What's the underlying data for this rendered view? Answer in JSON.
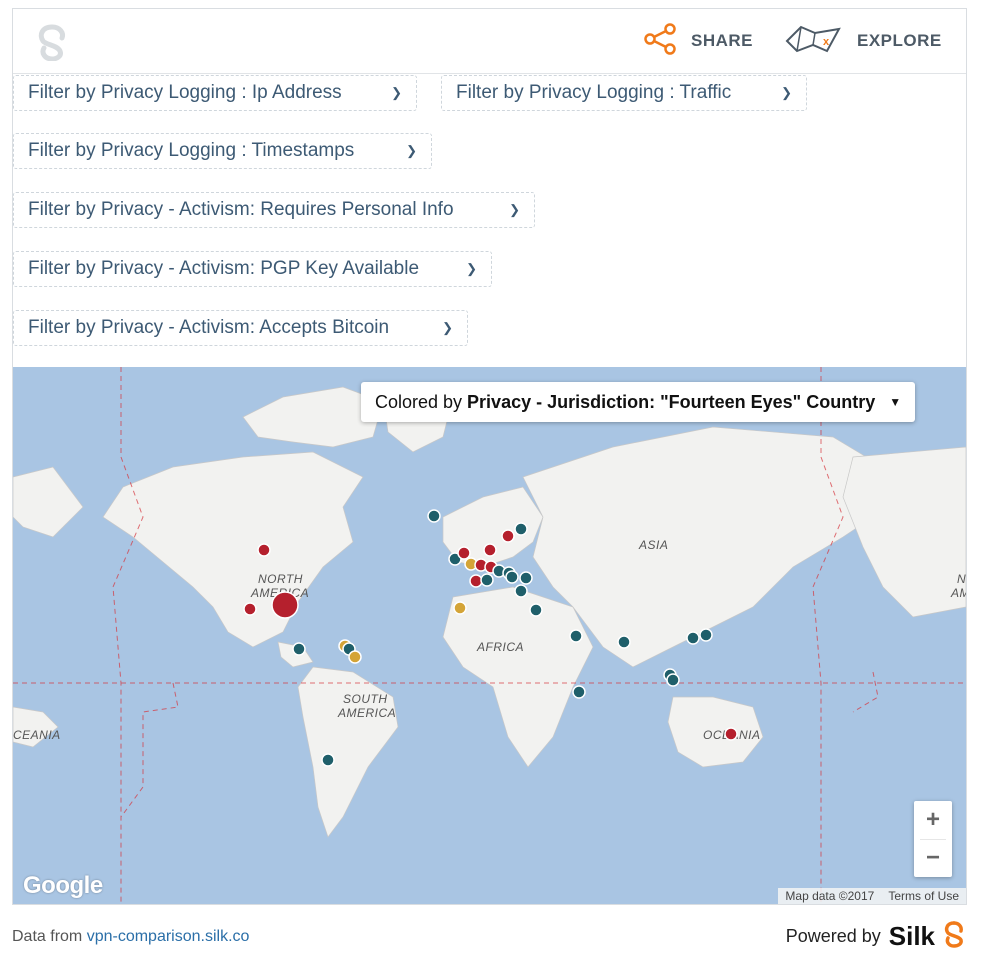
{
  "header": {
    "share_label": "SHARE",
    "explore_label": "EXPLORE"
  },
  "filters": [
    "Filter by Privacy Logging : Ip Address",
    "Filter by Privacy Logging : Traffic",
    "Filter by Privacy Logging : Timestamps",
    "Filter by Privacy - Activism: Requires Personal Info",
    "Filter by Privacy - Activism: PGP Key Available",
    "Filter by Privacy - Activism: Accepts Bitcoin"
  ],
  "map": {
    "colorby_prefix": "Colored by",
    "colorby_field": "Privacy - Jurisdiction: \"Fourteen Eyes\" Country",
    "labels": {
      "north_america": [
        "NORTH",
        "AMERICA"
      ],
      "south_america": [
        "SOUTH",
        "AMERICA"
      ],
      "africa": "AFRICA",
      "asia": "ASIA",
      "oceania_left": "CEANIA",
      "oceania_right": "OCEANIA",
      "na_right": [
        "NO",
        "AM"
      ]
    },
    "zoom_in": "+",
    "zoom_out": "−",
    "google_logo": "Google",
    "map_data": "Map data ©2017",
    "terms": "Terms of Use",
    "colors": {
      "red": "#b5202d",
      "teal": "#1f5f6a",
      "gold": "#d4a437",
      "ocean": "#a9c5e3",
      "land": "#f2f2f0"
    }
  },
  "footer": {
    "data_prefix": "Data from",
    "data_link": "vpn-comparison.silk.co",
    "powered_prefix": "Powered by",
    "powered_brand": "Silk"
  }
}
